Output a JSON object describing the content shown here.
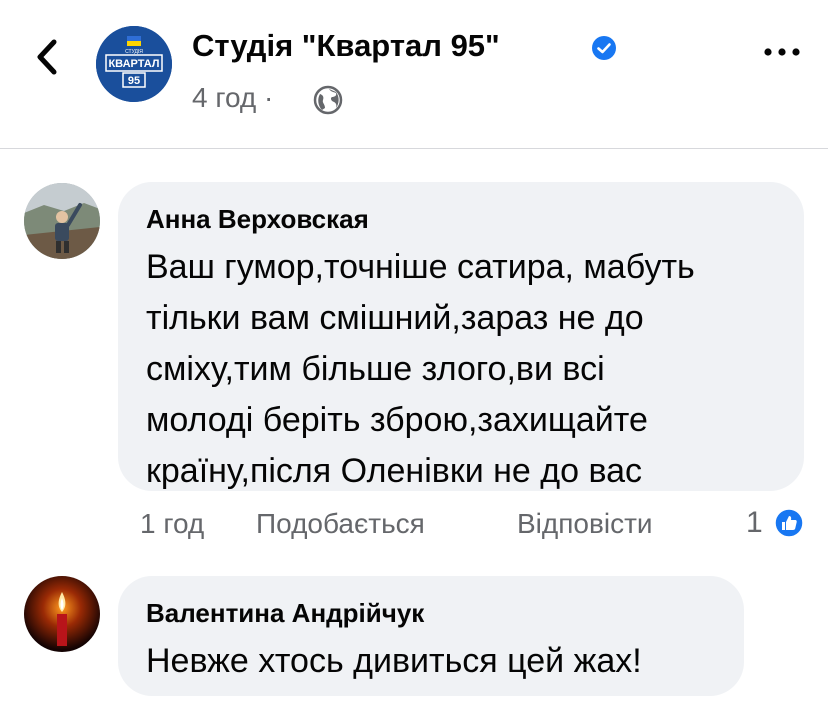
{
  "post": {
    "page_name": "Студія \"Квартал 95\"",
    "time": "4 год",
    "separator": "·",
    "logo_top": "СТУДІЯ",
    "logo_main": "КВАРТАЛ",
    "logo_num": "95"
  },
  "comments": [
    {
      "author": "Анна Верховская",
      "lines": [
        "Ваш гумор,точніше сатира, мабуть",
        "тільки вам смішний,зараз не до",
        "сміху,тим більше злого,ви всі",
        "молоді беріть зброю,захищайте",
        "країну,після Оленівки не до вас"
      ],
      "time": "1 год",
      "like_label": "Подобається",
      "reply_label": "Відповісти",
      "reaction_count": "1"
    },
    {
      "author": "Валентина Андрійчук",
      "lines": [
        "Невже хтось дивиться цей жах!"
      ]
    }
  ],
  "colors": {
    "verified": "#1877f2",
    "bubble": "#f0f2f5",
    "secondary": "#65676b",
    "like": "#1877f2"
  }
}
